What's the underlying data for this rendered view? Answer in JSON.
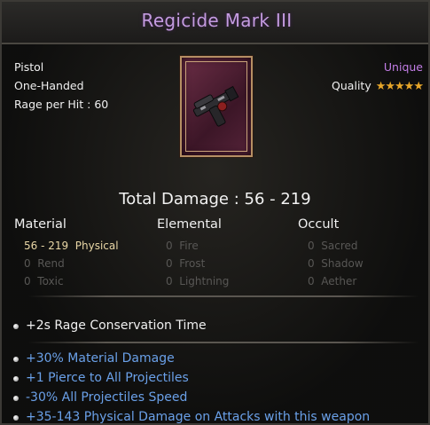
{
  "title": "Regicide Mark III",
  "item": {
    "type": "Pistol",
    "handedness": "One-Handed",
    "rage_per_hit": "Rage per Hit : 60",
    "rarity": "Unique",
    "quality_label": "Quality",
    "quality_stars": 5,
    "icon": "pistol-icon"
  },
  "total_damage": "Total Damage : 56 - 219",
  "columns": {
    "material": "Material",
    "elemental": "Elemental",
    "occult": "Occult"
  },
  "stats": {
    "physical": {
      "value": "56 - 219",
      "name": "Physical"
    },
    "rend": {
      "value": "0",
      "name": "Rend"
    },
    "toxic": {
      "value": "0",
      "name": "Toxic"
    },
    "fire": {
      "value": "0",
      "name": "Fire"
    },
    "frost": {
      "value": "0",
      "name": "Frost"
    },
    "lightning": {
      "value": "0",
      "name": "Lightning"
    },
    "sacred": {
      "value": "0",
      "name": "Sacred"
    },
    "shadow": {
      "value": "0",
      "name": "Shadow"
    },
    "aether": {
      "value": "0",
      "name": "Aether"
    }
  },
  "base_mod": "+2s Rage Conservation Time",
  "mods": [
    "+30% Material Damage",
    "+1 Pierce to All Projectiles",
    "-30% All Projectiles Speed",
    "+35-143 Physical Damage on Attacks with this weapon"
  ],
  "colors": {
    "title": "#c49be0",
    "unique": "#c37ee8",
    "mod": "#6aa0e8",
    "star": "#e8a72a",
    "active_stat": "#e9d7a6",
    "inactive_stat": "#585755"
  }
}
